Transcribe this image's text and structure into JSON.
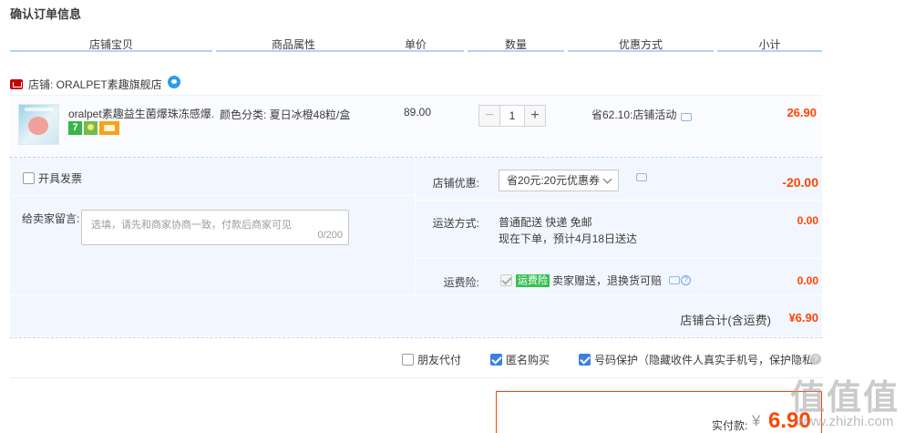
{
  "page": {
    "title": "确认订单信息"
  },
  "headers": [
    "店铺宝贝",
    "商品属性",
    "单价",
    "数量",
    "优惠方式",
    "小计"
  ],
  "shop": {
    "label": "店铺: ORALPET素趣旗舰店"
  },
  "item": {
    "name": "oralpet素趣益生菌爆珠冻感爆...",
    "attr": "颜色分类: 夏日冰橙48粒/盒",
    "price": "89.00",
    "quantity": "1",
    "minus": "−",
    "plus": "+",
    "discount": "省62.10:店铺活动",
    "subtotal": "26.90",
    "badges": [
      "7"
    ]
  },
  "invoice": {
    "label": "开具发票"
  },
  "message": {
    "label": "给卖家留言:",
    "placeholder": "选填，请先和商家协商一致，付款后商家可见",
    "count": "0/200"
  },
  "coupon": {
    "label": "店铺优惠:",
    "selected": "省20元:20元优惠券",
    "value": "-20.00"
  },
  "shipping": {
    "label": "运送方式:",
    "line1": "普通配送 快递 免邮",
    "line2": "现在下单，预计4月18日送达",
    "value": "0.00"
  },
  "insurance": {
    "label": "运费险:",
    "tag": "运费险",
    "text": "卖家赠送，退换货可赔",
    "value": "0.00",
    "help": "?"
  },
  "shop_total": {
    "label": "店铺合计(含运费)",
    "value": "¥6.90"
  },
  "options": {
    "friend_pay": "朋友代付",
    "anonymous": "匿名购买",
    "number_protect": "号码保护（隐藏收件人真实手机号，保护隐私）",
    "help": "?"
  },
  "payment": {
    "label": "实付款:",
    "currency": "¥",
    "amount": "6.90"
  },
  "watermark": {
    "big": "值值值",
    "small": "www.zhizhi.com"
  },
  "colors": {
    "accent": "#ff4400",
    "header_line": "#b2d1ff",
    "panel_bg": "#f2f7ff"
  }
}
